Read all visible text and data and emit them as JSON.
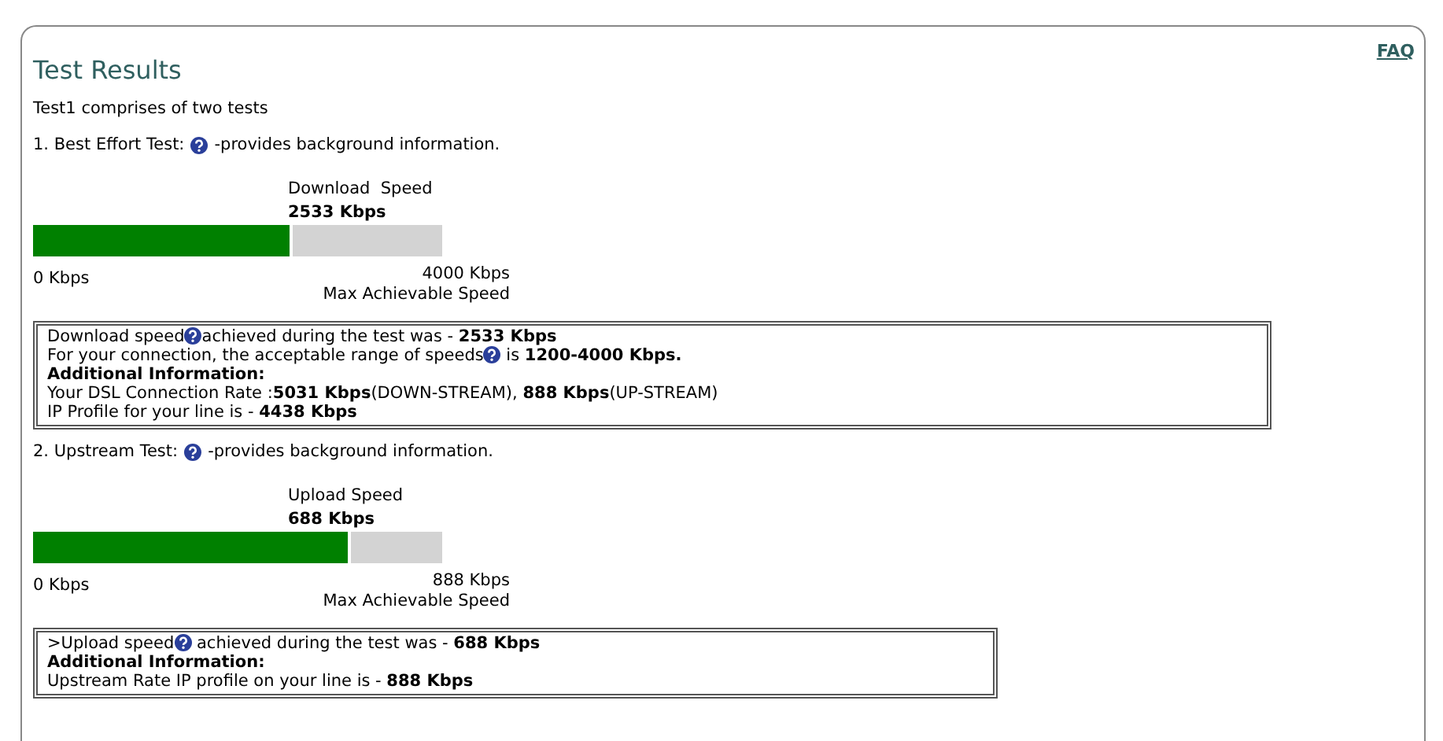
{
  "title": "Test Results",
  "faq_link": "FAQ",
  "intro": "Test1 comprises of two tests",
  "tests": [
    {
      "heading": "1. Best Effort Test:",
      "heading_note": "-provides background information.",
      "gauge_title": "Download  Speed",
      "gauge_value": "2533 Kbps",
      "level": 0.633,
      "min_label": "0 Kbps",
      "max_label": "4000 Kbps",
      "max_caption": "Max Achievable Speed",
      "details": [
        {
          "kind": "help",
          "before": "Download speed",
          "after": "achieved during the test was - **2533 Kbps**"
        },
        {
          "kind": "help",
          "before": "For your connection, the acceptable range of speeds",
          "after": " is **1200-4000 Kbps.**"
        },
        {
          "kind": "heading",
          "text": "Additional Information:"
        },
        {
          "kind": "plain",
          "text": "Your DSL Connection Rate :**5031 Kbps**(DOWN-STREAM), **888 Kbps**(UP-STREAM)"
        },
        {
          "kind": "plain",
          "text": "IP Profile for your line is - **4438 Kbps**"
        }
      ]
    },
    {
      "heading": "2. Upstream Test:",
      "heading_note": "-provides background information.",
      "gauge_title": "Upload Speed",
      "gauge_value": "688 Kbps",
      "level": 0.775,
      "min_label": "0 Kbps",
      "max_label": "888 Kbps",
      "max_caption": "Max Achievable Speed",
      "details": [
        {
          "kind": "help",
          "before": ">Upload speed",
          "after": " achieved during the test was - **688 Kbps**"
        },
        {
          "kind": "heading",
          "text": "Additional Information:"
        },
        {
          "kind": "plain",
          "text": "Upstream Rate IP profile on your line is - **888 Kbps**"
        }
      ]
    }
  ]
}
